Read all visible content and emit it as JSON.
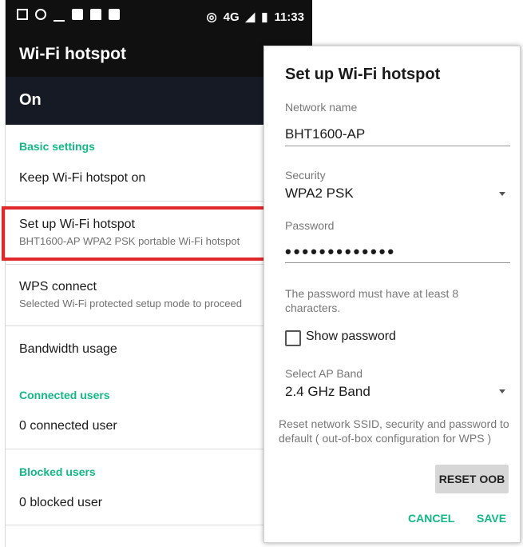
{
  "status_bar": {
    "clock": "11:33",
    "network": "4G",
    "icons": [
      "image-icon",
      "broadcast-icon",
      "missed-call-icon",
      "message-icon",
      "lock-icon",
      "sdcard-icon",
      "hotspot-icon",
      "signal-icon",
      "battery-icon"
    ]
  },
  "app_bar": {
    "title": "Wi-Fi hotspot"
  },
  "toggle": {
    "label": "On"
  },
  "settings": {
    "basic_header": "Basic settings",
    "keep_on": "Keep Wi-Fi hotspot on",
    "setup_title": "Set up Wi-Fi hotspot",
    "setup_sub": "BHT1600-AP WPA2 PSK portable Wi-Fi hotspot",
    "wps_title": "WPS connect",
    "wps_sub": "Selected Wi-Fi protected setup mode to proceed",
    "bandwidth": "Bandwidth usage",
    "connected_header": "Connected users",
    "connected_value": "0 connected user",
    "blocked_header": "Blocked users",
    "blocked_value": "0 blocked user"
  },
  "dialog": {
    "title": "Set up Wi-Fi hotspot",
    "network_label": "Network name",
    "network_value": "BHT1600-AP",
    "security_label": "Security",
    "security_value": "WPA2 PSK",
    "password_label": "Password",
    "password_value": "•••••••••••••",
    "password_hint": "The password must have at least 8 characters.",
    "show_password": "Show password",
    "band_label": "Select AP Band",
    "band_value": "2.4 GHz Band",
    "reset_text": "Reset network SSID, security and password to default ( out-of-box configuration for WPS )",
    "reset_button": "RESET OOB",
    "cancel": "CANCEL",
    "save": "SAVE"
  },
  "colors": {
    "accent": "#12b886",
    "highlight": "#e0282a",
    "header_bg": "#101010"
  }
}
